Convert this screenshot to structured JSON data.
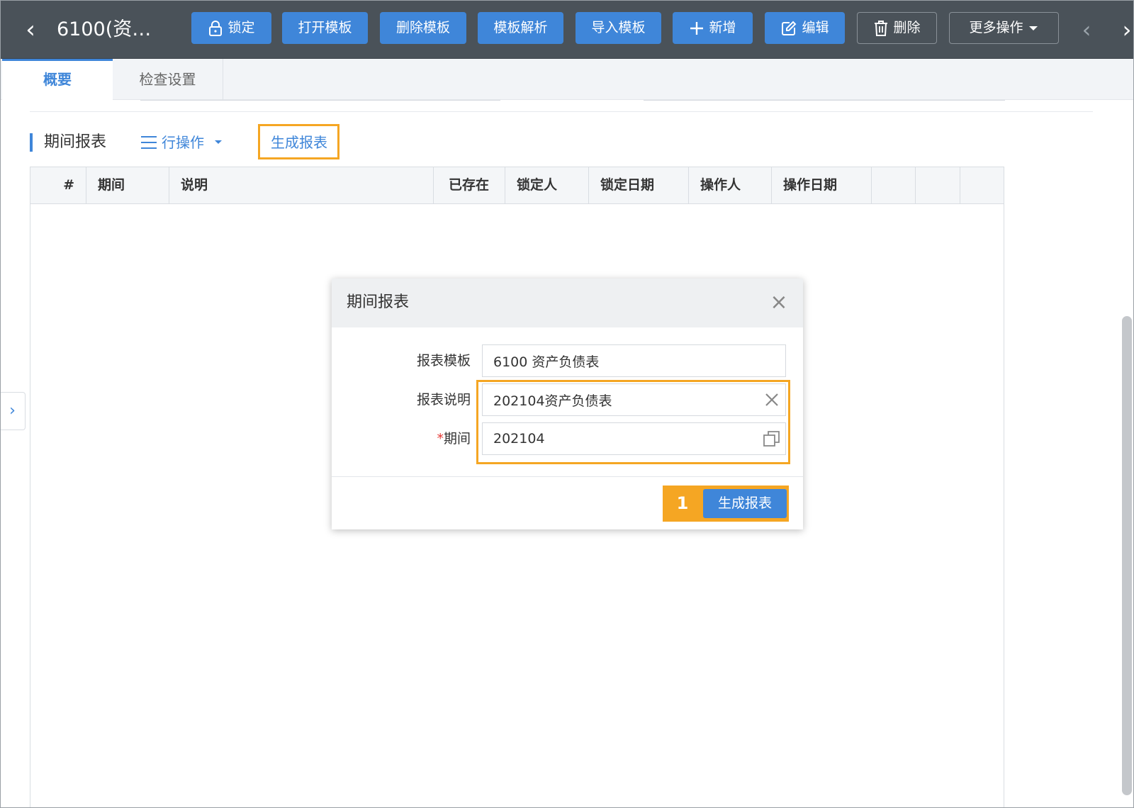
{
  "toolbar": {
    "back_glyph": "‹",
    "doc_title": "6100(资…",
    "lock_label": "锁定",
    "open_template_label": "打开模板",
    "delete_template_label": "删除模板",
    "parse_template_label": "模板解析",
    "import_template_label": "导入模板",
    "add_label": "新增",
    "edit_label": "编辑",
    "delete_label": "删除",
    "more_label": "更多操作",
    "prev_glyph": "‹",
    "next_glyph": "›"
  },
  "tabs": [
    {
      "label": "概要"
    },
    {
      "label": "检查设置"
    }
  ],
  "section": {
    "title": "期间报表",
    "row_ops_label": "行操作",
    "generate_link_label": "生成报表"
  },
  "table": {
    "columns": [
      "#",
      "期间",
      "说明",
      "已存在",
      "锁定人",
      "锁定日期",
      "操作人",
      "操作日期",
      "",
      "",
      ""
    ]
  },
  "side_toggle_glyph": "›",
  "modal": {
    "title": "期间报表",
    "close_glyph": "×",
    "template_label": "报表模板",
    "template_value": "6100 资产负债表",
    "desc_label": "报表说明",
    "desc_value": "202104资产负债表",
    "period_required_mark": "*",
    "period_label": "期间",
    "period_value": "202104",
    "step_number": "1",
    "generate_button_label": "生成报表"
  },
  "colors": {
    "toolbar_bg": "#4a5259",
    "primary": "#3f86d9",
    "highlight": "#f5a623",
    "required": "#e53935"
  }
}
